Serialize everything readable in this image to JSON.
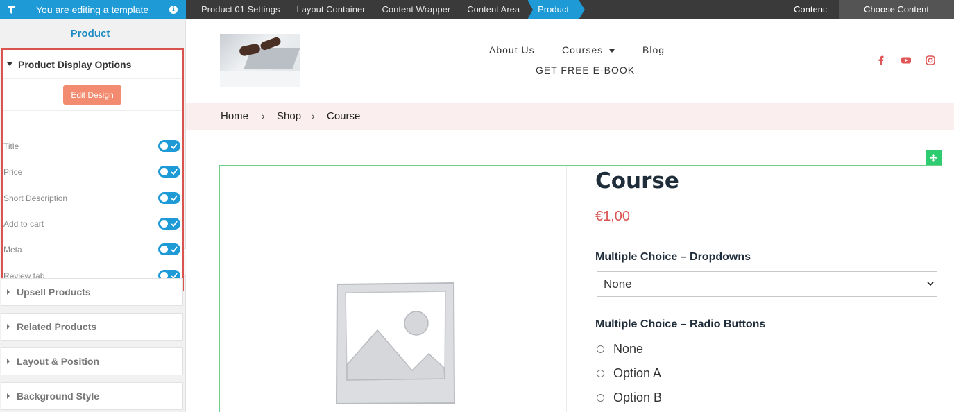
{
  "topbar": {
    "notice": "You are editing a template",
    "breadcrumbs": [
      "Product 01 Settings",
      "Layout Container",
      "Content Wrapper",
      "Content Area",
      "Product"
    ],
    "content_label": "Content:",
    "choose_content": "Choose Content"
  },
  "sidebar": {
    "title": "Product",
    "display_panel": {
      "label": "Product Display Options",
      "edit_button": "Edit Design",
      "toggles": [
        {
          "label": "Title",
          "on": true
        },
        {
          "label": "Price",
          "on": true
        },
        {
          "label": "Short Description",
          "on": true
        },
        {
          "label": "Add to cart",
          "on": true
        },
        {
          "label": "Meta",
          "on": true
        },
        {
          "label": "Review tab",
          "on": true
        }
      ]
    },
    "panels": [
      "Upsell Products",
      "Related Products",
      "Layout & Position",
      "Background Style"
    ]
  },
  "site": {
    "nav": {
      "about": "About Us",
      "courses": "Courses",
      "blog": "Blog",
      "ebook": "GET FREE E-BOOK"
    },
    "breadcrumb": [
      "Home",
      "Shop",
      "Course"
    ],
    "breadcrumb_sep": "›",
    "product": {
      "title": "Course",
      "price": "€1,00",
      "dropdown_label": "Multiple Choice – Dropdowns",
      "dropdown_value": "None",
      "radio_label": "Multiple Choice – Radio Buttons",
      "radio_options": [
        "None",
        "Option A",
        "Option B"
      ]
    }
  },
  "colors": {
    "accent": "#1e9ad6",
    "highlight_border": "#d9534f",
    "edit_button": "#f28b6f",
    "price": "#d9534f",
    "breadcrumb_bg": "#fbeeee",
    "outline": "#6fcf8a"
  }
}
